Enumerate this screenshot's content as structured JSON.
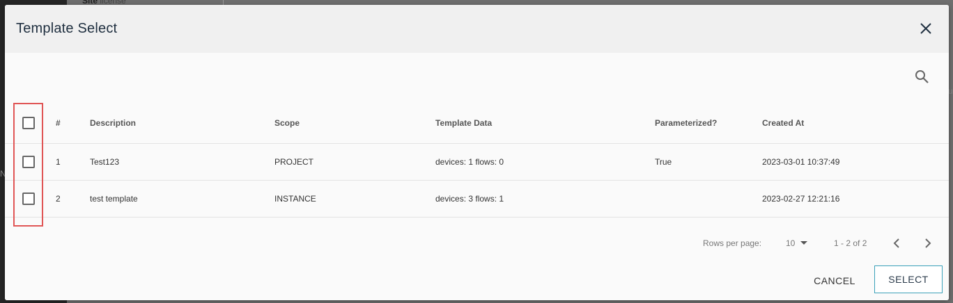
{
  "backdrop": {
    "fragment_bold": "Site",
    "fragment_light": "license",
    "edge_left": "N",
    "edge_right": "u"
  },
  "dialog": {
    "title": "Template Select",
    "close_icon": "close-icon",
    "search_icon": "search-icon"
  },
  "table": {
    "columns": [
      "#",
      "Description",
      "Scope",
      "Template Data",
      "Parameterized?",
      "Created At"
    ],
    "rows": [
      {
        "index": "1",
        "description": "Test123",
        "scope": "PROJECT",
        "template_data": "devices: 1 flows: 0",
        "parameterized": "True",
        "created_at": "2023-03-01 10:37:49"
      },
      {
        "index": "2",
        "description": "test template",
        "scope": "INSTANCE",
        "template_data": "devices: 3 flows: 1",
        "parameterized": "",
        "created_at": "2023-02-27 12:21:16"
      }
    ]
  },
  "pagination": {
    "rows_per_page_label": "Rows per page:",
    "rows_per_page_value": "10",
    "range": "1 - 2 of 2"
  },
  "footer": {
    "cancel_label": "CANCEL",
    "select_label": "SELECT"
  },
  "colors": {
    "highlight": "#e05555",
    "accent": "#3aa0b8"
  }
}
